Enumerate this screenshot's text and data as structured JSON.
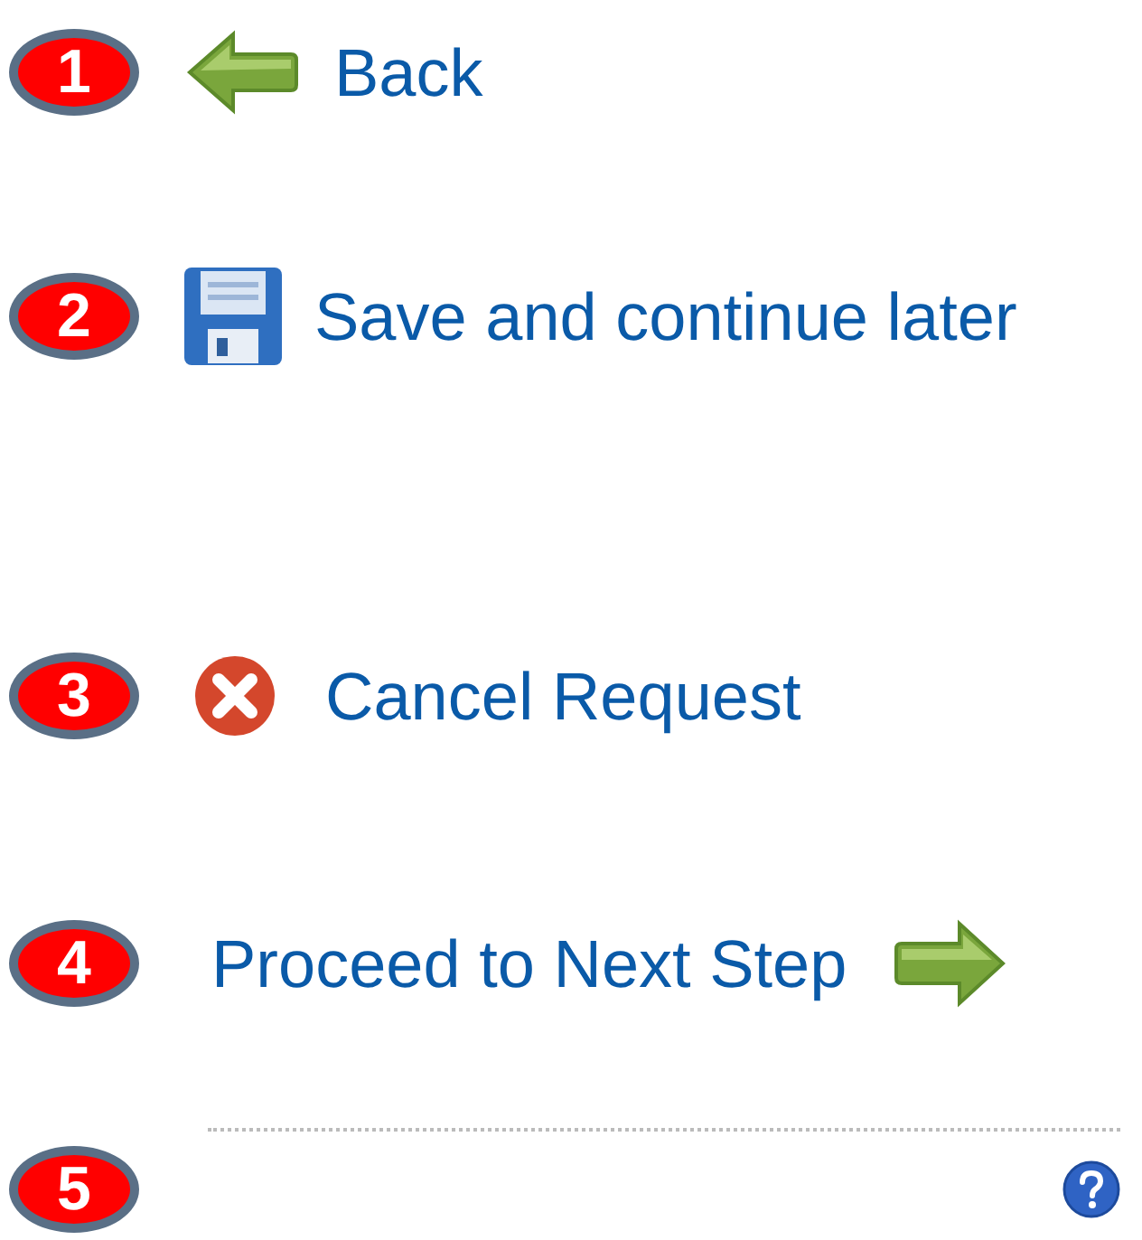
{
  "steps": [
    {
      "number": "1",
      "kind": "back",
      "label": "Back"
    },
    {
      "number": "2",
      "kind": "save",
      "label": "Save and continue later"
    },
    {
      "number": "3",
      "kind": "cancel",
      "label": "Cancel Request"
    },
    {
      "number": "4",
      "kind": "next",
      "label": "Proceed to Next Step"
    },
    {
      "number": "5",
      "kind": "help"
    }
  ]
}
